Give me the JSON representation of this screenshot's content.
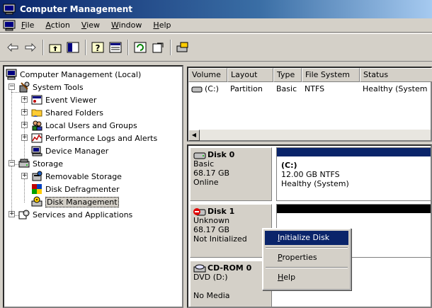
{
  "window": {
    "title": "Computer Management"
  },
  "menubar": {
    "items": [
      {
        "accel": "F",
        "rest": "ile"
      },
      {
        "accel": "A",
        "rest": "ction"
      },
      {
        "accel": "V",
        "rest": "iew"
      },
      {
        "accel": "W",
        "rest": "indow"
      },
      {
        "accel": "H",
        "rest": "elp"
      }
    ]
  },
  "toolbar": {
    "buttons": [
      "back-arrow-icon",
      "forward-arrow-icon",
      "up-folder-icon",
      "show-hide-tree-icon",
      "help-icon",
      "properties-icon",
      "refresh-icon",
      "export-icon",
      "disk-settings-icon"
    ]
  },
  "tree": {
    "root": "Computer Management (Local)",
    "system_tools": "System Tools",
    "event_viewer": "Event Viewer",
    "shared_folders": "Shared Folders",
    "local_users": "Local Users and Groups",
    "perf_logs": "Performance Logs and Alerts",
    "device_manager": "Device Manager",
    "storage": "Storage",
    "removable_storage": "Removable Storage",
    "disk_defrag": "Disk Defragmenter",
    "disk_management": "Disk Management",
    "services": "Services and Applications"
  },
  "volume_list": {
    "columns": [
      "Volume",
      "Layout",
      "Type",
      "File System",
      "Status"
    ],
    "rows": [
      {
        "volume": "(C:)",
        "layout": "Partition",
        "type": "Basic",
        "fs": "NTFS",
        "status": "Healthy (System"
      }
    ]
  },
  "disks": [
    {
      "name": "Disk 0",
      "type": "Basic",
      "size": "68.17 GB",
      "status": "Online",
      "partition": {
        "label": "(C:)",
        "size": "12.00 GB NTFS",
        "status": "Healthy (System)"
      }
    },
    {
      "name": "Disk 1",
      "type": "Unknown",
      "size": "68.17 GB",
      "status": "Not Initialized"
    },
    {
      "name": "CD-ROM 0",
      "type": "DVD (D:)",
      "size": "",
      "status": "No Media"
    }
  ],
  "context_menu": {
    "items": [
      {
        "accel": "I",
        "rest": "nitialize Disk"
      },
      {
        "accel": "P",
        "rest": "roperties"
      },
      {
        "accel": "H",
        "rest": "elp"
      }
    ]
  },
  "colors": {
    "title_start": "#0a246a",
    "title_end": "#a6caf0",
    "highlight": "#0a246a",
    "partition_primary": "#0a246a",
    "unallocated": "#000000"
  }
}
